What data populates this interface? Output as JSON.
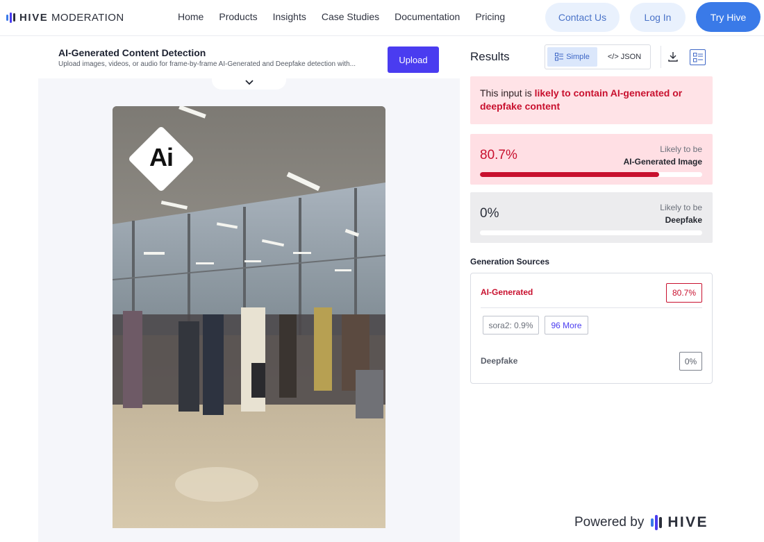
{
  "nav": {
    "logo_strong": "HIVE",
    "logo_light": "MODERATION",
    "links": [
      "Home",
      "Products",
      "Insights",
      "Case Studies",
      "Documentation",
      "Pricing"
    ],
    "contact_label": "Contact Us",
    "login_label": "Log In",
    "try_label": "Try Hive"
  },
  "left": {
    "title": "AI-Generated Content Detection",
    "subtitle": "Upload images, videos, or audio for frame-by-frame AI-Generated and Deepfake detection with...",
    "upload_label": "Upload",
    "badge_text": "Ai"
  },
  "results": {
    "title": "Results",
    "toggle_simple": "Simple",
    "toggle_json": "</> JSON",
    "verdict_prefix": "This input is ",
    "verdict_strong": "likely to contain AI-generated or deepfake content",
    "ai_score": {
      "value": "80.7%",
      "fraction": 0.807,
      "label_top": "Likely to be",
      "label_main": "AI-Generated Image"
    },
    "df_score": {
      "value": "0%",
      "fraction": 0,
      "label_top": "Likely to be",
      "label_main": "Deepfake"
    },
    "sources_title": "Generation Sources",
    "sources": {
      "ai_label": "AI-Generated",
      "ai_pct": "80.7%",
      "chip_sora": "sora2: 0.9%",
      "chip_more": "96 More",
      "df_label": "Deepfake",
      "df_pct": "0%"
    }
  },
  "footer": {
    "powered_by": "Powered by",
    "brand": "HIVE"
  },
  "colors": {
    "accent_blue": "#3a7ae8",
    "upload_purple": "#4a3cf0",
    "alert_red": "#c8102e",
    "logo_bars": [
      "#3a7ae8",
      "#4a3cf0",
      "#2b2f3a"
    ]
  }
}
